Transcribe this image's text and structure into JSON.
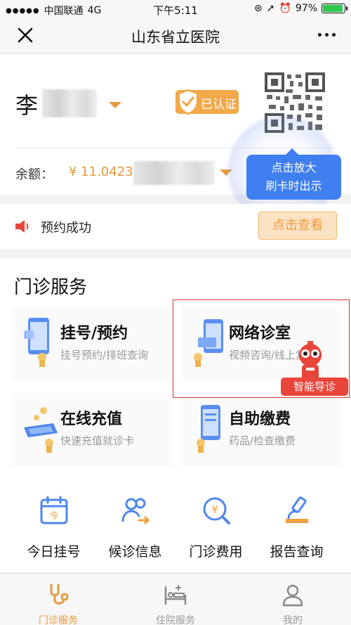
{
  "status_bar": {
    "carrier": "中国联通",
    "network": "4G",
    "time": "下午5:11",
    "battery": "97%"
  },
  "nav": {
    "title": "山东省立医院",
    "close_icon": "close-icon",
    "more_icon": "more-icon"
  },
  "card": {
    "user_name": "李",
    "verified_label": "已认证",
    "balance_label": "余额：",
    "balance_value": "¥ 11.0423",
    "tap_hint_line1": "点击放大",
    "tap_hint_line2": "刷卡时出示"
  },
  "notice": {
    "text": "预约成功",
    "button_label": "点击查看"
  },
  "outpatient": {
    "title": "门诊服务",
    "services": [
      {
        "title": "挂号/预约",
        "subtitle": "挂号预约/排班查询"
      },
      {
        "title": "网络诊室",
        "subtitle": "视频咨询/线上复诊"
      },
      {
        "title": "在线充值",
        "subtitle": "快速充值就诊卡"
      },
      {
        "title": "自助缴费",
        "subtitle": "药品/检查缴费"
      }
    ],
    "guide_badge": "智能导诊",
    "quick_actions": [
      {
        "label": "今日挂号",
        "icon": "calendar-today-icon"
      },
      {
        "label": "候诊信息",
        "icon": "waiting-patients-icon"
      },
      {
        "label": "门诊费用",
        "icon": "fee-search-icon"
      },
      {
        "label": "报告查询",
        "icon": "microscope-icon"
      }
    ]
  },
  "tabs": [
    {
      "label": "门诊服务",
      "icon": "stethoscope-icon",
      "active": true
    },
    {
      "label": "住院服务",
      "icon": "hospital-bed-icon",
      "active": false
    },
    {
      "label": "我的",
      "icon": "profile-icon",
      "active": false
    }
  ],
  "colors": {
    "accent_orange": "#e49a3c",
    "tooltip_blue": "#3f7ff0",
    "highlight_red": "#e0322e",
    "success_green": "#2ec84e"
  }
}
